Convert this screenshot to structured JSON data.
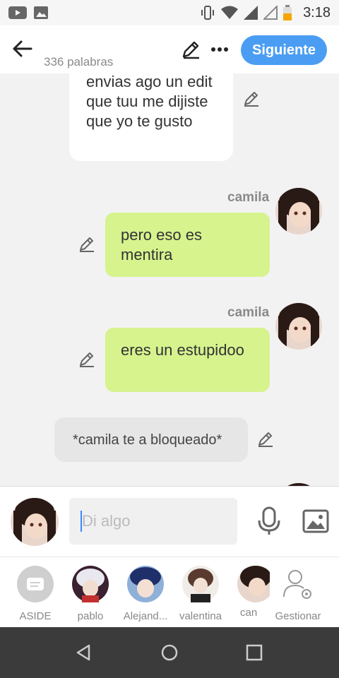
{
  "status": {
    "time": "3:18"
  },
  "topbar": {
    "word_count": "336 palabras",
    "next_label": "Siguiente"
  },
  "messages": {
    "m1": {
      "text": "envias  ago un edit que tuu me dijiste que yo te gusto"
    },
    "m2": {
      "author": "camila",
      "text": "pero eso es mentira"
    },
    "m3": {
      "author": "camila",
      "text": "eres un estupidoo"
    },
    "m4": {
      "text": "*camila te a bloqueado*"
    }
  },
  "input": {
    "placeholder": "Di algo"
  },
  "characters": [
    {
      "label": "ASIDE"
    },
    {
      "label": "pablo"
    },
    {
      "label": "Alejand..."
    },
    {
      "label": "valentina"
    },
    {
      "label": "can"
    },
    {
      "label": "Gestionar"
    }
  ],
  "colors": {
    "accent": "#4a9df2",
    "bubble_green": "#d6f38e",
    "navbar": "#3b3b3b"
  }
}
